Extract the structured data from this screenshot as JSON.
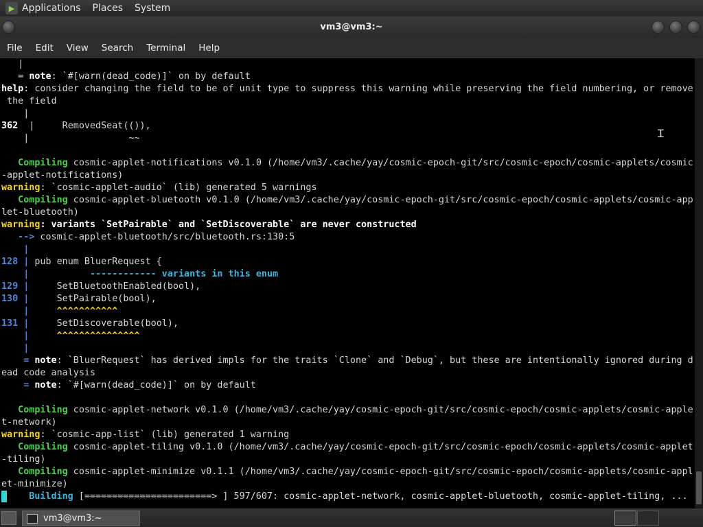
{
  "top_panel": {
    "items": [
      "Applications",
      "Places",
      "System"
    ]
  },
  "window": {
    "title": "vm3@vm3:~"
  },
  "menubar": {
    "items": [
      "File",
      "Edit",
      "View",
      "Search",
      "Terminal",
      "Help"
    ]
  },
  "terminal_lines": [
    [
      [
        "",
        "   |"
      ]
    ],
    [
      [
        "",
        "   = "
      ],
      [
        "b",
        "note"
      ],
      [
        "",
        ": `#[warn(dead_code)]` on by default"
      ]
    ],
    [
      [
        "b",
        "help"
      ],
      [
        "",
        ": consider changing the field to be of unit type to suppress this warning while preserving the field numbering, or remove"
      ]
    ],
    [
      [
        "",
        " the field"
      ]
    ],
    [
      [
        "",
        "    |"
      ]
    ],
    [
      [
        "b",
        "362"
      ],
      [
        "",
        ""
      ],
      [
        "",
        ""
      ],
      [
        "",
        ""
      ],
      [
        "",
        ""
      ],
      [
        "",
        ""
      ],
      [
        "",
        ""
      ],
      [
        "",
        ""
      ],
      [
        "",
        "  |     RemovedSeat(()),"
      ]
    ],
    [
      [
        "",
        "    |                  ~~"
      ]
    ],
    [
      [
        "",
        ""
      ]
    ],
    [
      [
        "g",
        "   Compiling"
      ],
      [
        "",
        " cosmic-applet-notifications v0.1.0 (/home/vm3/.cache/yay/cosmic-epoch-git/src/cosmic-epoch/cosmic-applets/cosmic"
      ]
    ],
    [
      [
        "",
        "-applet-notifications)"
      ]
    ],
    [
      [
        "y",
        "warning"
      ],
      [
        "",
        ": `cosmic-applet-audio` (lib) generated 5 warnings"
      ]
    ],
    [
      [
        "g",
        "   Compiling"
      ],
      [
        "",
        " cosmic-applet-bluetooth v0.1.0 (/home/vm3/.cache/yay/cosmic-epoch-git/src/cosmic-epoch/cosmic-applets/cosmic-app"
      ]
    ],
    [
      [
        "",
        "let-bluetooth)"
      ]
    ],
    [
      [
        "y",
        "warning"
      ],
      [
        "b",
        ": variants `SetPairable` and `SetDiscoverable` are never constructed"
      ]
    ],
    [
      [
        "ln",
        "   -->"
      ],
      [
        "",
        " cosmic-applet-bluetooth/src/bluetooth.rs:130:5"
      ]
    ],
    [
      [
        "ln",
        "    |"
      ]
    ],
    [
      [
        "ln",
        "128"
      ],
      [
        "ln",
        " |"
      ],
      [
        "",
        " pub enum BluerRequest {"
      ]
    ],
    [
      [
        "ln",
        "    |"
      ],
      [
        "",
        "           "
      ],
      [
        "cy",
        "------------ variants in this enum"
      ]
    ],
    [
      [
        "ln",
        "129"
      ],
      [
        "ln",
        " |"
      ],
      [
        "",
        "     SetBluetoothEnabled(bool),"
      ]
    ],
    [
      [
        "ln",
        "130"
      ],
      [
        "ln",
        " |"
      ],
      [
        "",
        "     SetPairable(bool),"
      ]
    ],
    [
      [
        "ln",
        "    |"
      ],
      [
        "",
        "     "
      ],
      [
        "y",
        "^^^^^^^^^^^"
      ]
    ],
    [
      [
        "ln",
        "131"
      ],
      [
        "ln",
        " |"
      ],
      [
        "",
        "     SetDiscoverable(bool),"
      ]
    ],
    [
      [
        "ln",
        "    |"
      ],
      [
        "",
        "     "
      ],
      [
        "y",
        "^^^^^^^^^^^^^^^"
      ]
    ],
    [
      [
        "ln",
        "    |"
      ]
    ],
    [
      [
        "ln",
        "    ="
      ],
      [
        "b",
        " note"
      ],
      [
        "",
        ": `BluerRequest` has derived impls for the traits `Clone` and `Debug`, but these are intentionally ignored during d"
      ]
    ],
    [
      [
        "",
        "ead code analysis"
      ]
    ],
    [
      [
        "ln",
        "    ="
      ],
      [
        "b",
        " note"
      ],
      [
        "",
        ": `#[warn(dead_code)]` on by default"
      ]
    ],
    [
      [
        "",
        ""
      ]
    ],
    [
      [
        "g",
        "   Compiling"
      ],
      [
        "",
        " cosmic-applet-network v0.1.0 (/home/vm3/.cache/yay/cosmic-epoch-git/src/cosmic-epoch/cosmic-applets/cosmic-apple"
      ]
    ],
    [
      [
        "",
        "t-network)"
      ]
    ],
    [
      [
        "y",
        "warning"
      ],
      [
        "",
        ": `cosmic-app-list` (lib) generated 1 warning"
      ]
    ],
    [
      [
        "g",
        "   Compiling"
      ],
      [
        "",
        " cosmic-applet-tiling v0.1.0 (/home/vm3/.cache/yay/cosmic-epoch-git/src/cosmic-epoch/cosmic-applets/cosmic-applet"
      ]
    ],
    [
      [
        "",
        "-tiling)"
      ]
    ],
    [
      [
        "g",
        "   Compiling"
      ],
      [
        "",
        " cosmic-applet-minimize v0.1.1 (/home/vm3/.cache/yay/cosmic-epoch-git/src/cosmic-epoch/cosmic-applets/cosmic-appl"
      ]
    ],
    [
      [
        "",
        "et-minimize)"
      ]
    ],
    [
      [
        "cursor",
        ""
      ],
      [
        "cy",
        "    Building"
      ],
      [
        "",
        " [=======================> ] 597/607: cosmic-applet-network, cosmic-applet-bluetooth, cosmic-applet-tiling, ..."
      ]
    ]
  ],
  "taskbar": {
    "task_label": "vm3@vm3:~"
  }
}
